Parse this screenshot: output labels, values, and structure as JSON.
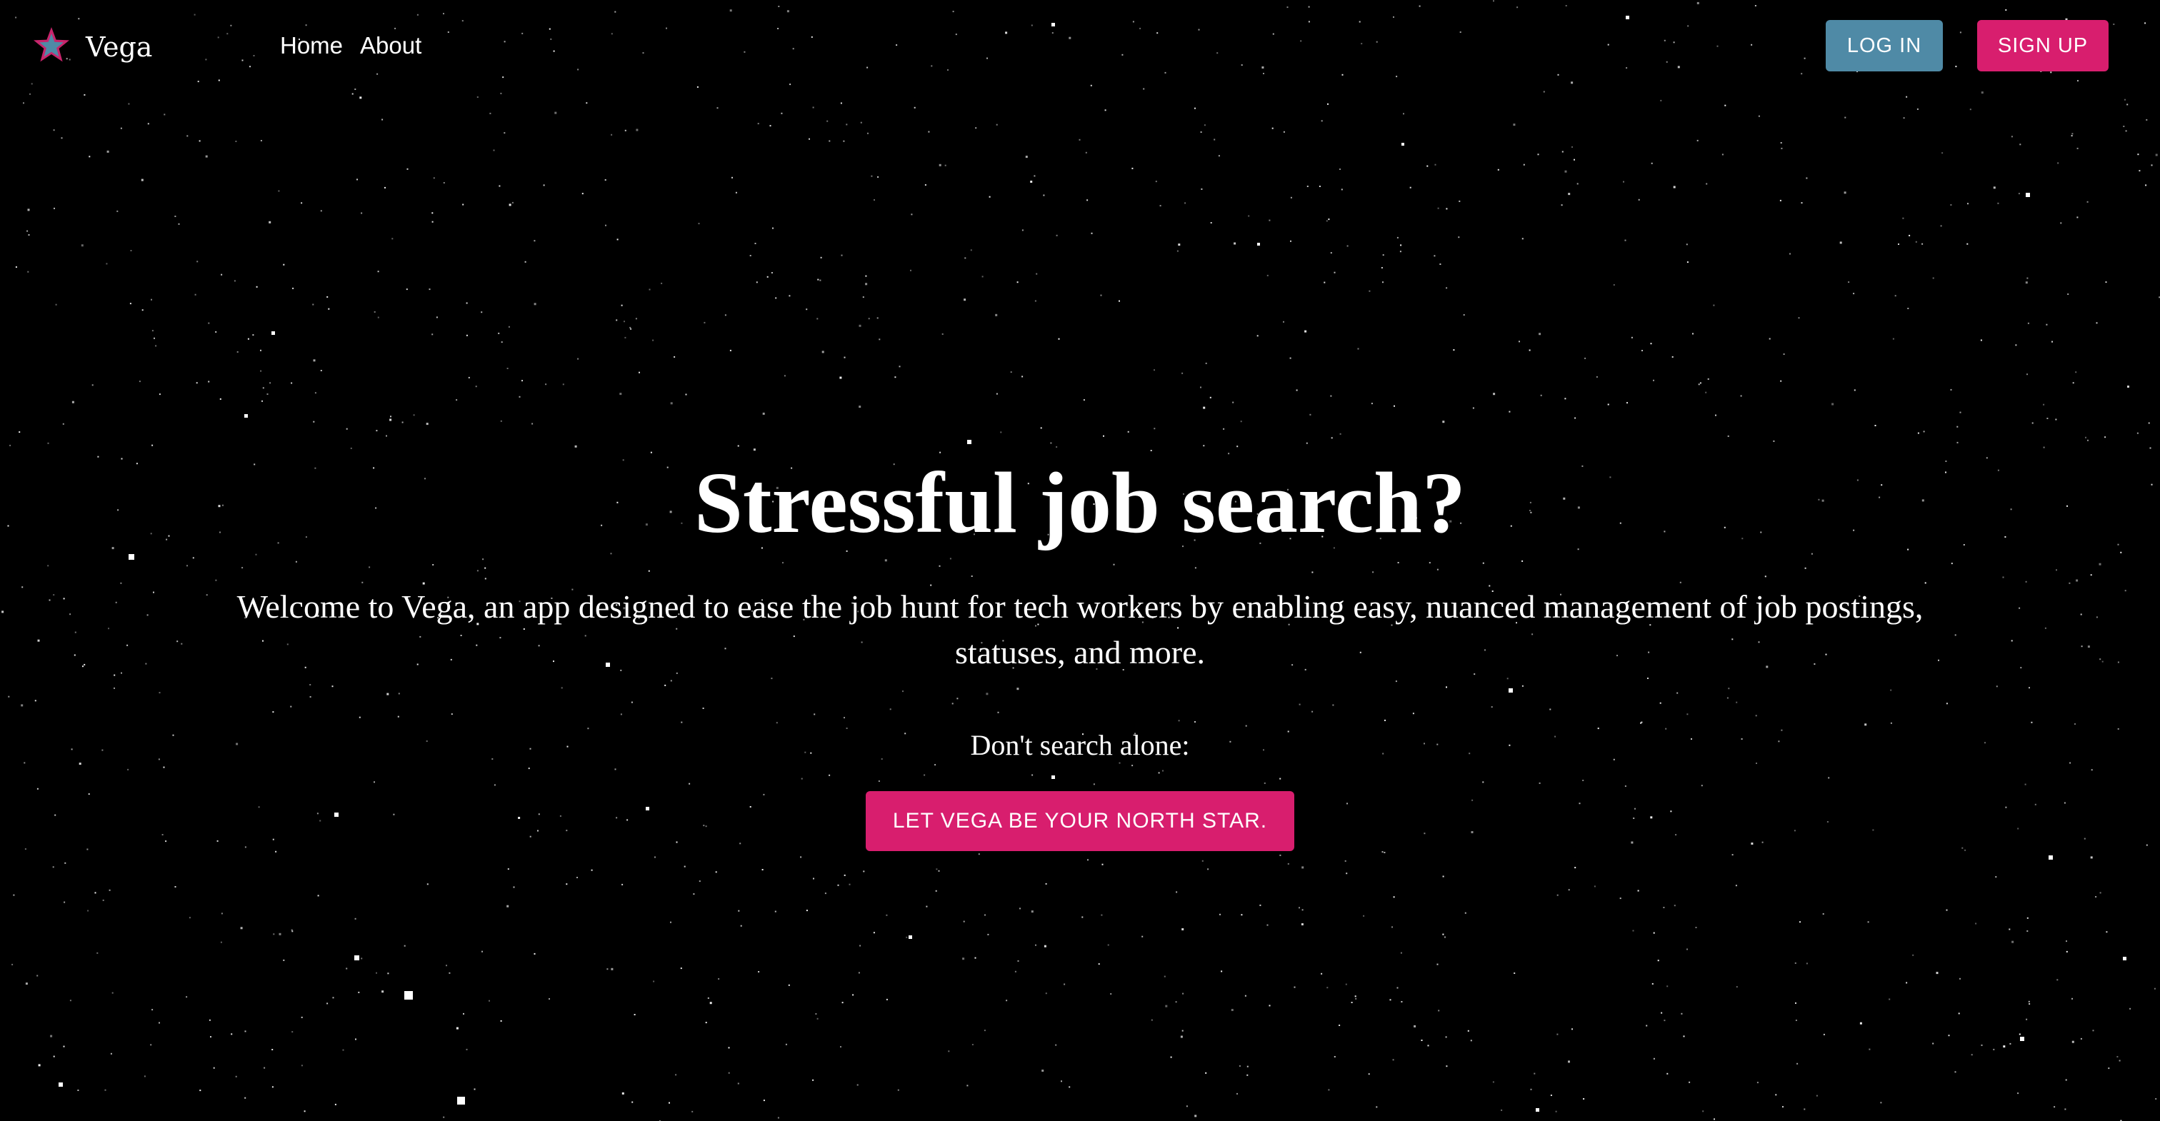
{
  "brand": {
    "name": "Vega",
    "icon": "star-icon",
    "icon_colors": {
      "outer": "#c8256c",
      "inner": "#4f8aa6"
    }
  },
  "nav": {
    "links": [
      {
        "label": "Home"
      },
      {
        "label": "About"
      }
    ]
  },
  "auth": {
    "login_label": "LOG IN",
    "signup_label": "SIGN UP"
  },
  "hero": {
    "title": "Stressful job search?",
    "subtitle": "Welcome to Vega, an app designed to ease the job hunt for tech workers by enabling easy, nuanced management of job postings, statuses, and more.",
    "prompt": "Don't search alone:",
    "cta_label": "LET VEGA BE YOUR NORTH STAR."
  },
  "colors": {
    "background": "#000000",
    "primary_accent": "#d81e6e",
    "secondary_accent": "#4f8aa6",
    "text": "#ffffff"
  }
}
